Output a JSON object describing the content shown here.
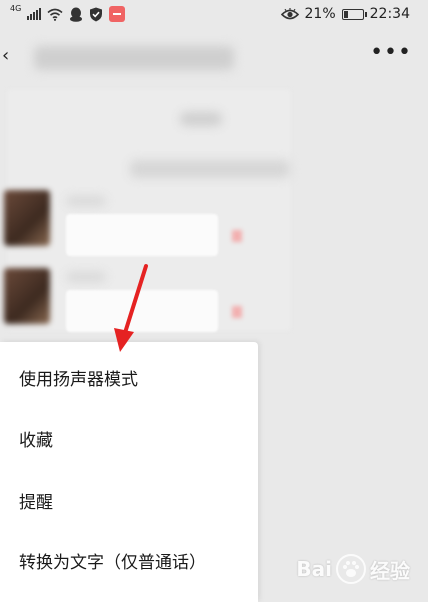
{
  "status_bar": {
    "network": "4G",
    "battery_percent": "21%",
    "battery_level": 0.21,
    "time": "22:34"
  },
  "header": {
    "back_icon": "chevron-left-icon",
    "more_icon": "more-icon"
  },
  "context_menu": {
    "items": [
      {
        "label": "使用扬声器模式"
      },
      {
        "label": "收藏"
      },
      {
        "label": "提醒"
      },
      {
        "label": "转换为文字（仅普通话）"
      }
    ]
  },
  "annotation": {
    "arrow_color": "#e52222"
  },
  "watermark": {
    "text_left": "Bai",
    "text_right": "经验"
  }
}
